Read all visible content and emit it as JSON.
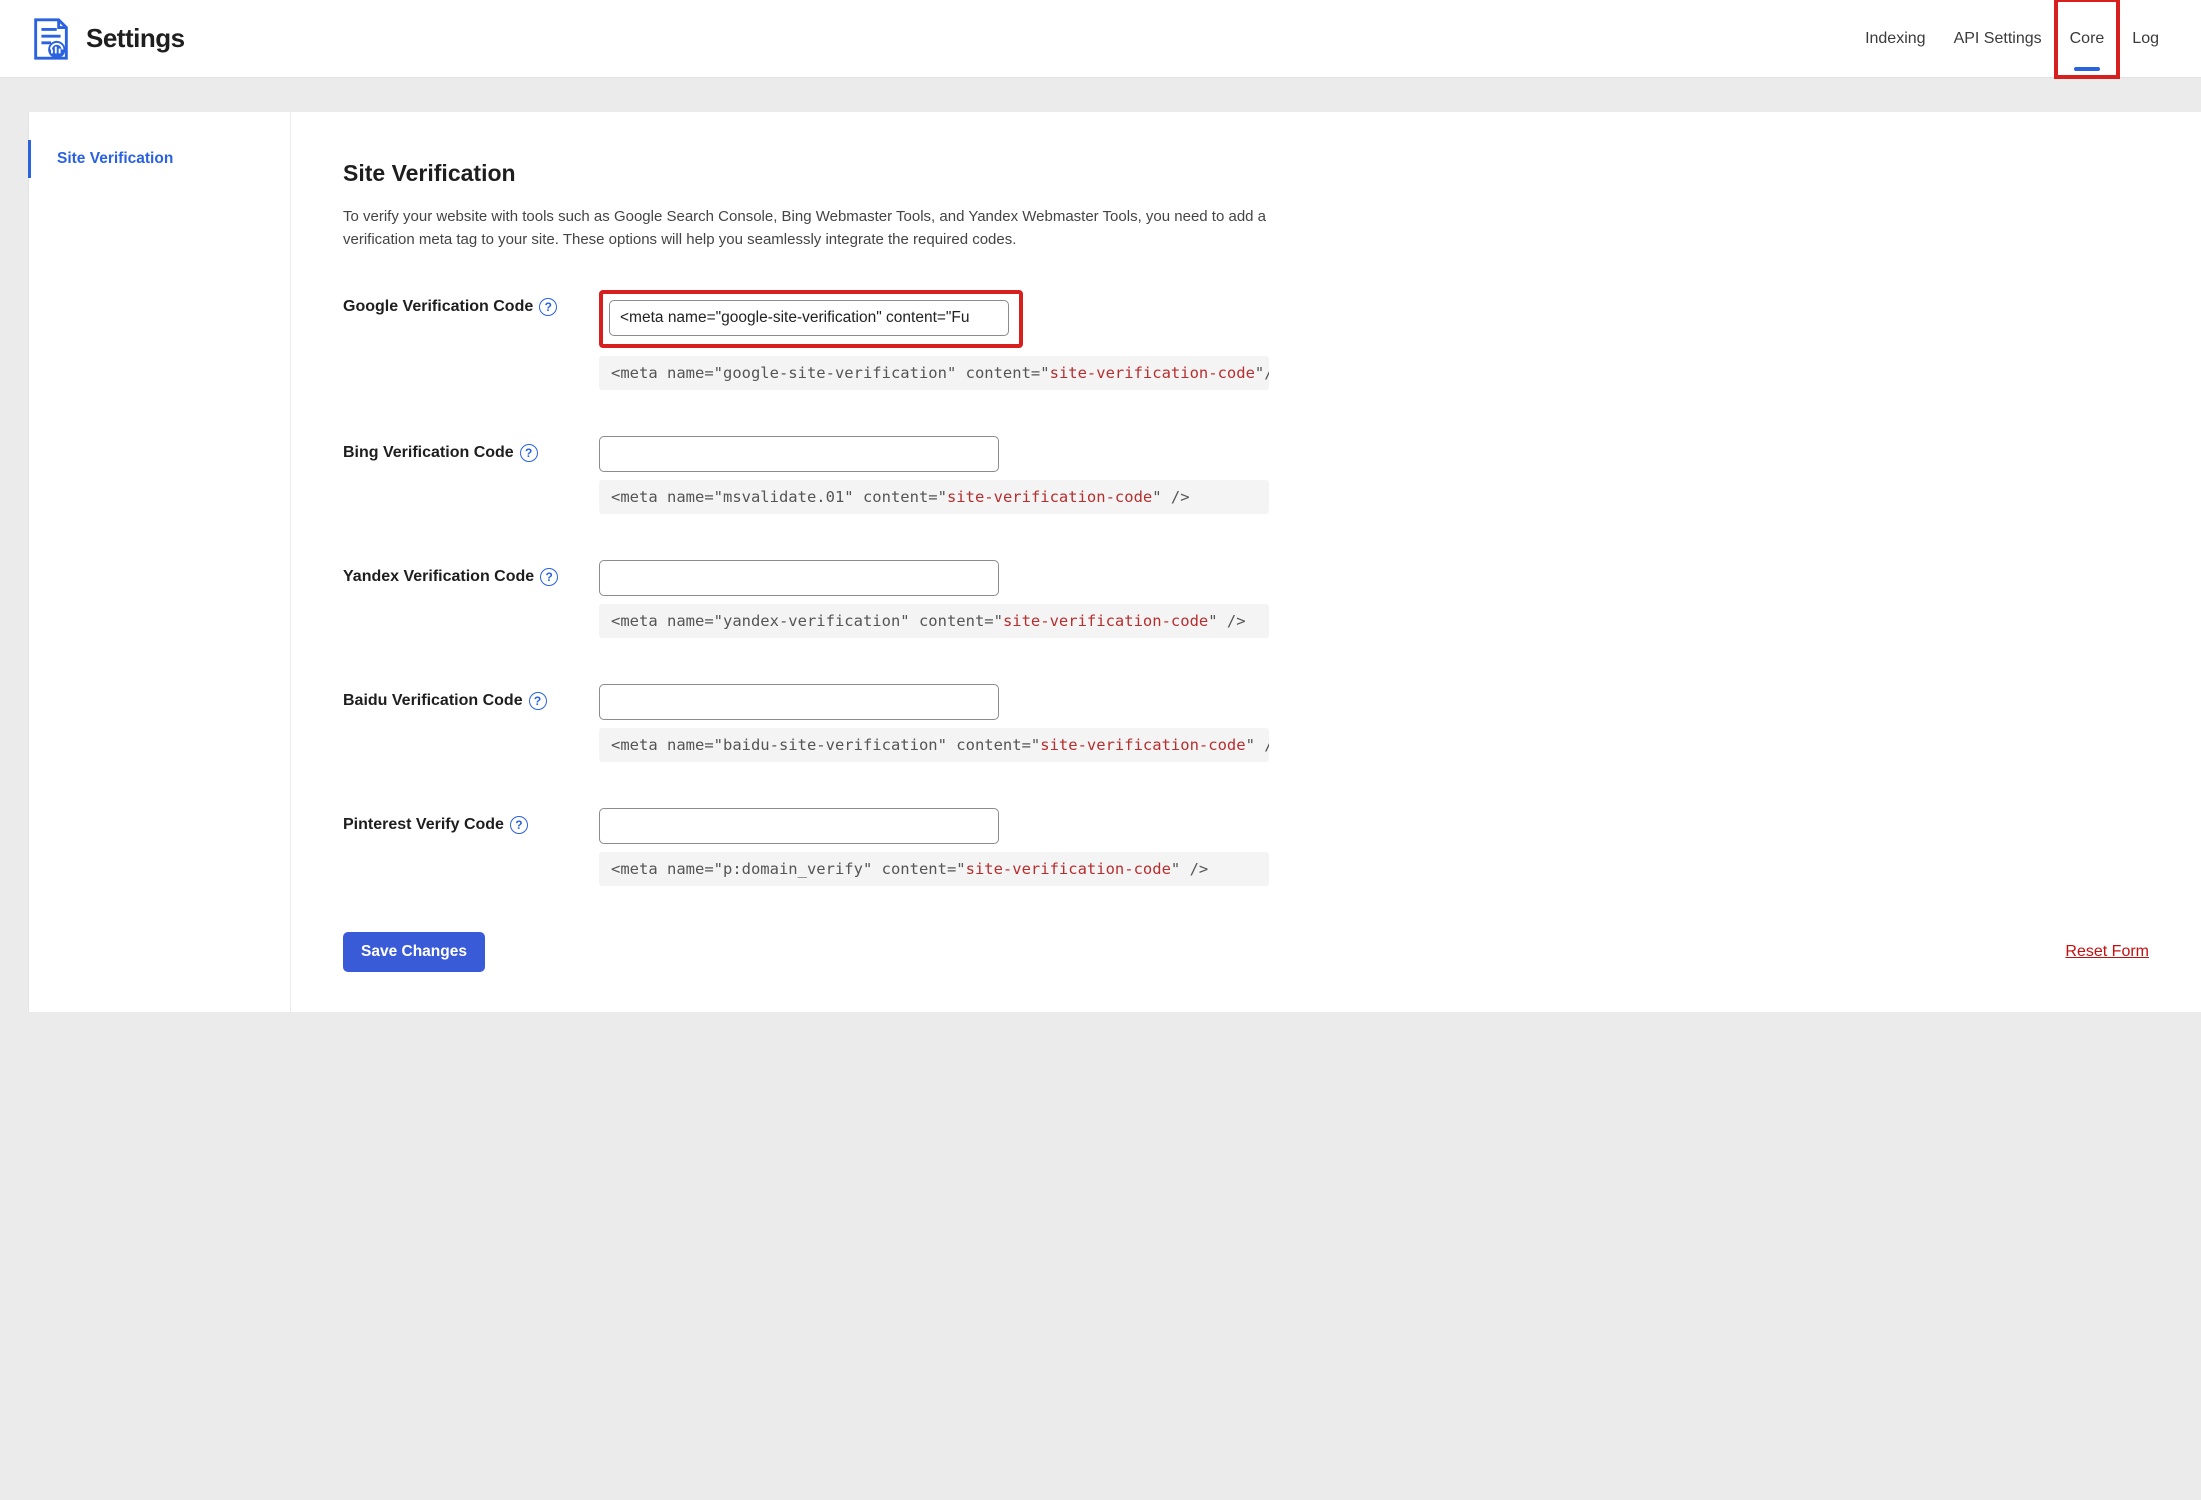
{
  "header": {
    "title": "Settings",
    "tabs": [
      {
        "label": "Indexing",
        "active": false,
        "highlight": false
      },
      {
        "label": "API Settings",
        "active": false,
        "highlight": false
      },
      {
        "label": "Core",
        "active": true,
        "highlight": true
      },
      {
        "label": "Log",
        "active": false,
        "highlight": false
      }
    ]
  },
  "sidebar": {
    "items": [
      {
        "label": "Site Verification",
        "active": true
      }
    ]
  },
  "section": {
    "title": "Site Verification",
    "description": "To verify your website with tools such as Google Search Console, Bing Webmaster Tools, and Yandex Webmaster Tools, you need to add a verification meta tag to your site. These options will help you seamlessly integrate the required codes."
  },
  "fields": {
    "google": {
      "label": "Google Verification Code",
      "value": "<meta name=\"google-site-verification\" content=\"Fu",
      "hint_prefix": "<meta name=\"google-site-verification\" content=\"",
      "hint_code": "site-verification-code",
      "hint_suffix": "\"/>",
      "highlight": true
    },
    "bing": {
      "label": "Bing Verification Code",
      "value": "",
      "hint_prefix": "<meta name=\"msvalidate.01\" content=\"",
      "hint_code": "site-verification-code",
      "hint_suffix": "\" />"
    },
    "yandex": {
      "label": "Yandex Verification Code",
      "value": "",
      "hint_prefix": "<meta name=\"yandex-verification\" content=\"",
      "hint_code": "site-verification-code",
      "hint_suffix": "\" />"
    },
    "baidu": {
      "label": "Baidu Verification Code",
      "value": "",
      "hint_prefix": "<meta name=\"baidu-site-verification\" content=\"",
      "hint_code": "site-verification-code",
      "hint_suffix": "\" />"
    },
    "pinterest": {
      "label": "Pinterest Verify Code",
      "value": "",
      "hint_prefix": "<meta name=\"p:domain_verify\" content=\"",
      "hint_code": "site-verification-code",
      "hint_suffix": "\" />"
    }
  },
  "actions": {
    "save_label": "Save Changes",
    "reset_label": "Reset Form"
  }
}
